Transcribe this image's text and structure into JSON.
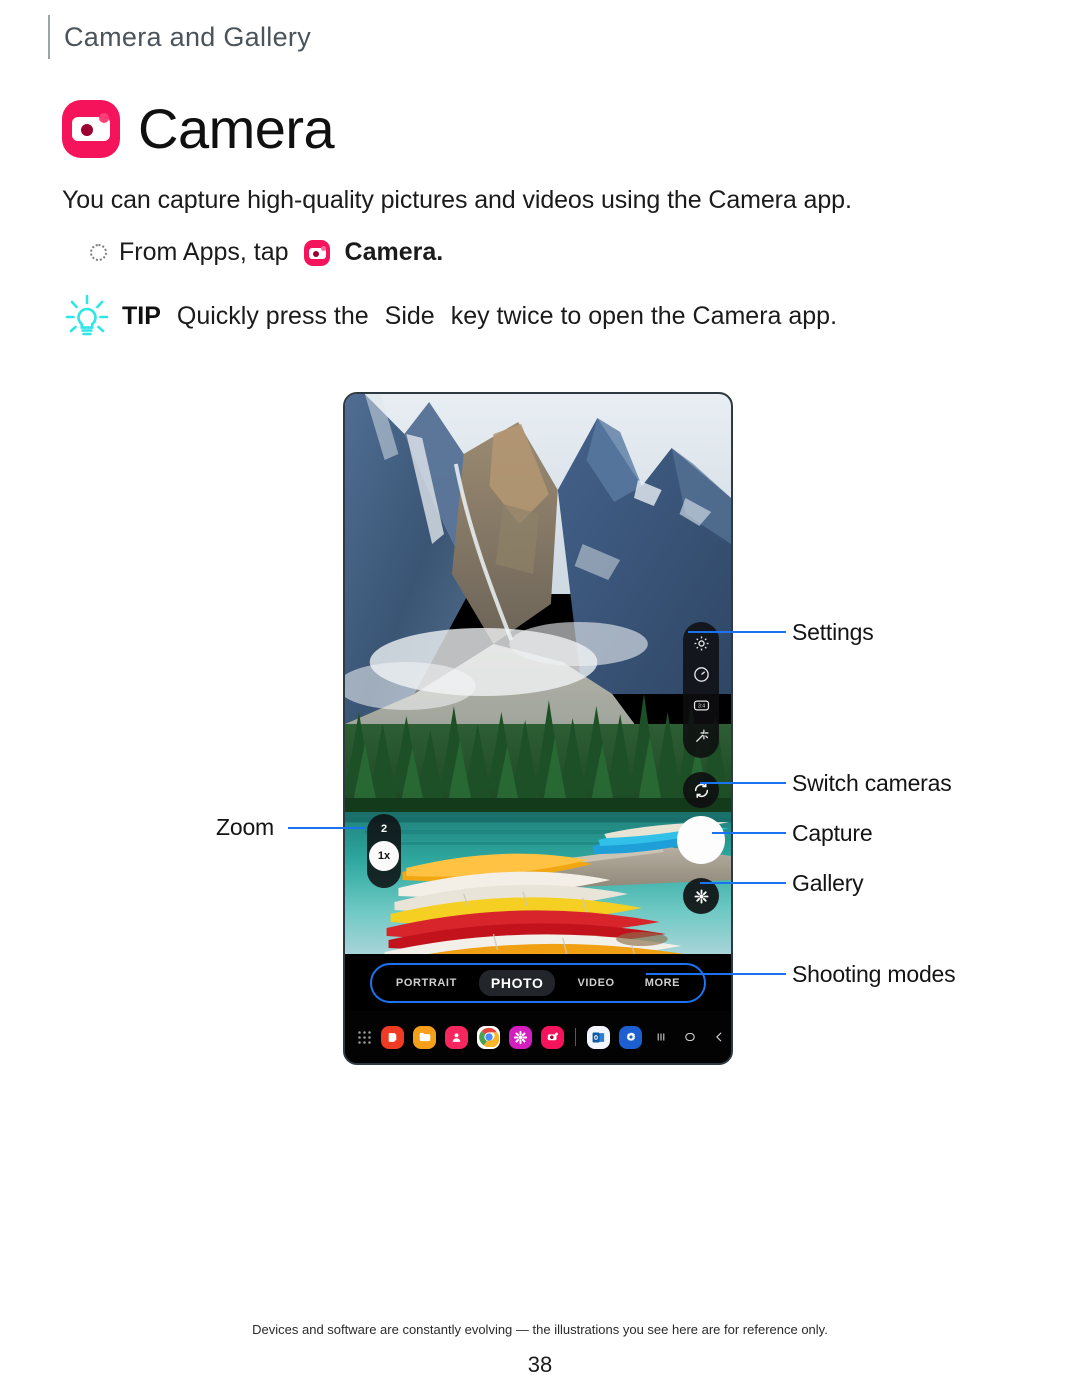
{
  "header": {
    "title": "Camera and Gallery"
  },
  "page": {
    "title": "Camera",
    "app_icon": "camera-icon",
    "intro": "You can capture high-quality pictures and videos using the Camera app.",
    "bullet": {
      "prefix": "From Apps, tap",
      "app_name": "Camera.",
      "icon": "camera-icon"
    },
    "tip": {
      "icon": "lightbulb-icon",
      "label": "TIP",
      "text_before": "Quickly press the",
      "emphasis": "Side",
      "text_after": "key twice to open the Camera app."
    }
  },
  "device": {
    "viewfinder_scene": "Mountain lake with moored canoes",
    "settings_panel": {
      "icons": [
        "gear-icon",
        "timer-icon",
        "aspect-ratio-icon",
        "effects-icon"
      ],
      "aspect_ratio_label": "3:4"
    },
    "zoom_control": {
      "top_value": "2",
      "selected_value": "1x"
    },
    "shooting_modes": {
      "items": [
        "PORTRAIT",
        "PHOTO",
        "VIDEO",
        "MORE"
      ],
      "active": "PHOTO"
    },
    "taskbar": {
      "apps": [
        {
          "name": "app-drawer-icon",
          "color": "#d9d9d9"
        },
        {
          "name": "samsung-notes-icon",
          "color": "#ef3a24"
        },
        {
          "name": "my-files-icon",
          "color": "#f6a01a"
        },
        {
          "name": "contacts-icon",
          "color": "#f5275e"
        },
        {
          "name": "chrome-icon",
          "color": "#ffffff"
        },
        {
          "name": "gallery-icon",
          "color": "#d41ec0"
        },
        {
          "name": "camera-icon",
          "color": "#f5145b"
        }
      ],
      "recent": [
        {
          "name": "outlook-icon",
          "color": "#f2f6fc"
        },
        {
          "name": "settings-icon",
          "color": "#1b5fd0"
        }
      ],
      "nav": [
        {
          "name": "recents-button",
          "glyph": "|||"
        },
        {
          "name": "home-button",
          "glyph": "O"
        },
        {
          "name": "back-button",
          "glyph": "<"
        }
      ]
    }
  },
  "callouts": {
    "accent_color": "#1a73f0",
    "left": [
      {
        "label": "Zoom",
        "target": "zoom-control"
      }
    ],
    "right": [
      {
        "label": "Settings",
        "target": "settings-panel"
      },
      {
        "label": "Switch cameras",
        "target": "switch-camera-button"
      },
      {
        "label": "Capture",
        "target": "capture-button"
      },
      {
        "label": "Gallery",
        "target": "gallery-button"
      },
      {
        "label": "Shooting modes",
        "target": "shooting-modes-bar"
      }
    ]
  },
  "footer": {
    "note": "Devices and software are constantly evolving — the illustrations you see here are for reference only.",
    "page_number": "38"
  }
}
